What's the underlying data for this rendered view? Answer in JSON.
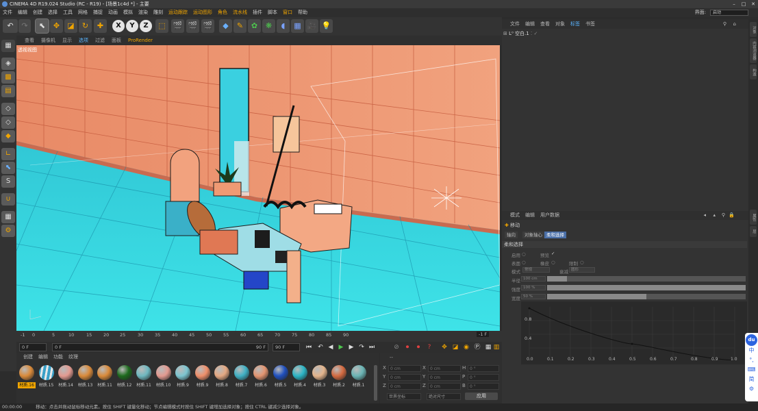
{
  "window": {
    "title": "CINEMA 4D R19.024 Studio (RC - R19) - [场景1c4d *] - 主要"
  },
  "menu": {
    "items": [
      "文件",
      "编辑",
      "创建",
      "选择",
      "工具",
      "网格",
      "捕捉",
      "动画",
      "模拟",
      "渲染",
      "雕刻",
      "运动跟踪",
      "运动图形",
      "角色",
      "流水线",
      "插件",
      "脚本",
      "窗口",
      "帮助"
    ],
    "highlight_index": 11,
    "layout_label": "界面:",
    "layout_value": "启动"
  },
  "toolbar": {
    "undo": "↶",
    "axes": [
      "X",
      "Y",
      "Z"
    ]
  },
  "viewport": {
    "menu": [
      "查看",
      "摄像机",
      "显示",
      "选项",
      "过滤",
      "面板",
      "ProRender"
    ],
    "active_index": 3,
    "label": "透视视图"
  },
  "timeline": {
    "ticks": [
      "-1",
      "0",
      "5",
      "10",
      "15",
      "20",
      "25",
      "30",
      "35",
      "40",
      "45",
      "50",
      "55",
      "60",
      "65",
      "70",
      "75",
      "80",
      "85",
      "90"
    ],
    "frame_readout": "-1 F"
  },
  "playback": {
    "current": "0 F",
    "range_start": "0 F",
    "range_end": "90 F",
    "end": "90 F"
  },
  "materials": {
    "menu": [
      "创建",
      "编辑",
      "功能",
      "纹理"
    ],
    "items": [
      {
        "name": "材质.16",
        "color": "#d98a3a",
        "selected": true
      },
      {
        "name": "材质.15",
        "color": "#3aa0c8",
        "stripe": true
      },
      {
        "name": "材质.14",
        "color": "#e39a90"
      },
      {
        "name": "材质.13",
        "color": "#d98a3a"
      },
      {
        "name": "材质.11",
        "color": "#d98a3a"
      },
      {
        "name": "材质.12",
        "color": "#1d6a1d"
      },
      {
        "name": "材质.11",
        "color": "#6fb8c0"
      },
      {
        "name": "材质.10",
        "color": "#e39a90"
      },
      {
        "name": "材质.9",
        "color": "#7cc5d0"
      },
      {
        "name": "材质.9",
        "color": "#ef8f6a"
      },
      {
        "name": "材质.8",
        "color": "#e4a882"
      },
      {
        "name": "材质.7",
        "color": "#3fb0c4"
      },
      {
        "name": "材质.6",
        "color": "#e39470"
      },
      {
        "name": "材质.5",
        "color": "#1f4fbe"
      },
      {
        "name": "材质.4",
        "color": "#2ab4c4"
      },
      {
        "name": "材质.3",
        "color": "#e3b48c"
      },
      {
        "name": "材质.2",
        "color": "#d46a40"
      },
      {
        "name": "材质.1",
        "color": "#6ab4b4"
      }
    ]
  },
  "coords": {
    "header": "--",
    "rows": [
      {
        "a": "X",
        "av": "0 cm",
        "b": "X",
        "bv": "0 cm",
        "c": "H",
        "cv": "0 °"
      },
      {
        "a": "Y",
        "av": "0 cm",
        "b": "Y",
        "bv": "0 cm",
        "c": "P",
        "cv": "0 °"
      },
      {
        "a": "Z",
        "av": "0 cm",
        "b": "Z",
        "bv": "0 cm",
        "c": "B",
        "cv": "0 °"
      }
    ],
    "mode": "世界坐标",
    "scale": "绝对尺寸",
    "apply": "应用"
  },
  "objects": {
    "menu": [
      "文件",
      "编辑",
      "查看",
      "对象",
      "标签",
      "书签"
    ],
    "active_index": 4,
    "row_label": "空白.1"
  },
  "attributes": {
    "menu": [
      "模式",
      "编辑",
      "用户数据"
    ],
    "title": "移动",
    "tabs": [
      "轴向",
      "对象轴心",
      "柔和选择"
    ],
    "active_tab": 2,
    "section": "柔和选择",
    "rows": {
      "enable": "启用",
      "preview": "预览",
      "surface": "表面",
      "rubber": "橡皮",
      "restrict": "限制",
      "mode": "模式",
      "mode_value": "常规",
      "falloff": "衰减",
      "falloff_value": "圆形",
      "radius": "半径",
      "radius_value": "100 cm",
      "strength": "强度",
      "strength_value": "100 %",
      "width": "宽度",
      "width_value": "50 %"
    },
    "strength_level": 1.0,
    "width_level": 0.5,
    "radius_level": 0.1,
    "graph": {
      "y_labels": [
        "0.8",
        "0.4"
      ],
      "x_labels": [
        "0.0",
        "0.1",
        "0.2",
        "0.3",
        "0.4",
        "0.5",
        "0.6",
        "0.7",
        "0.8",
        "0.9",
        "1.0"
      ]
    }
  },
  "status": {
    "time": "00:00:00",
    "text": "移动：点击并拖动鼠标移动元素。按住 SHIFT 键量化移动；节点编辑模式时按住 SHIFT 键增加选择对象；按住 CTRL 键减少选择对象。"
  },
  "right_tabs": [
    "对象",
    "内容浏览器",
    "构造",
    "属性",
    "层"
  ],
  "ime": {
    "labels": [
      "du",
      "中",
      "°,",
      "⌨",
      "简",
      "⚙"
    ]
  }
}
